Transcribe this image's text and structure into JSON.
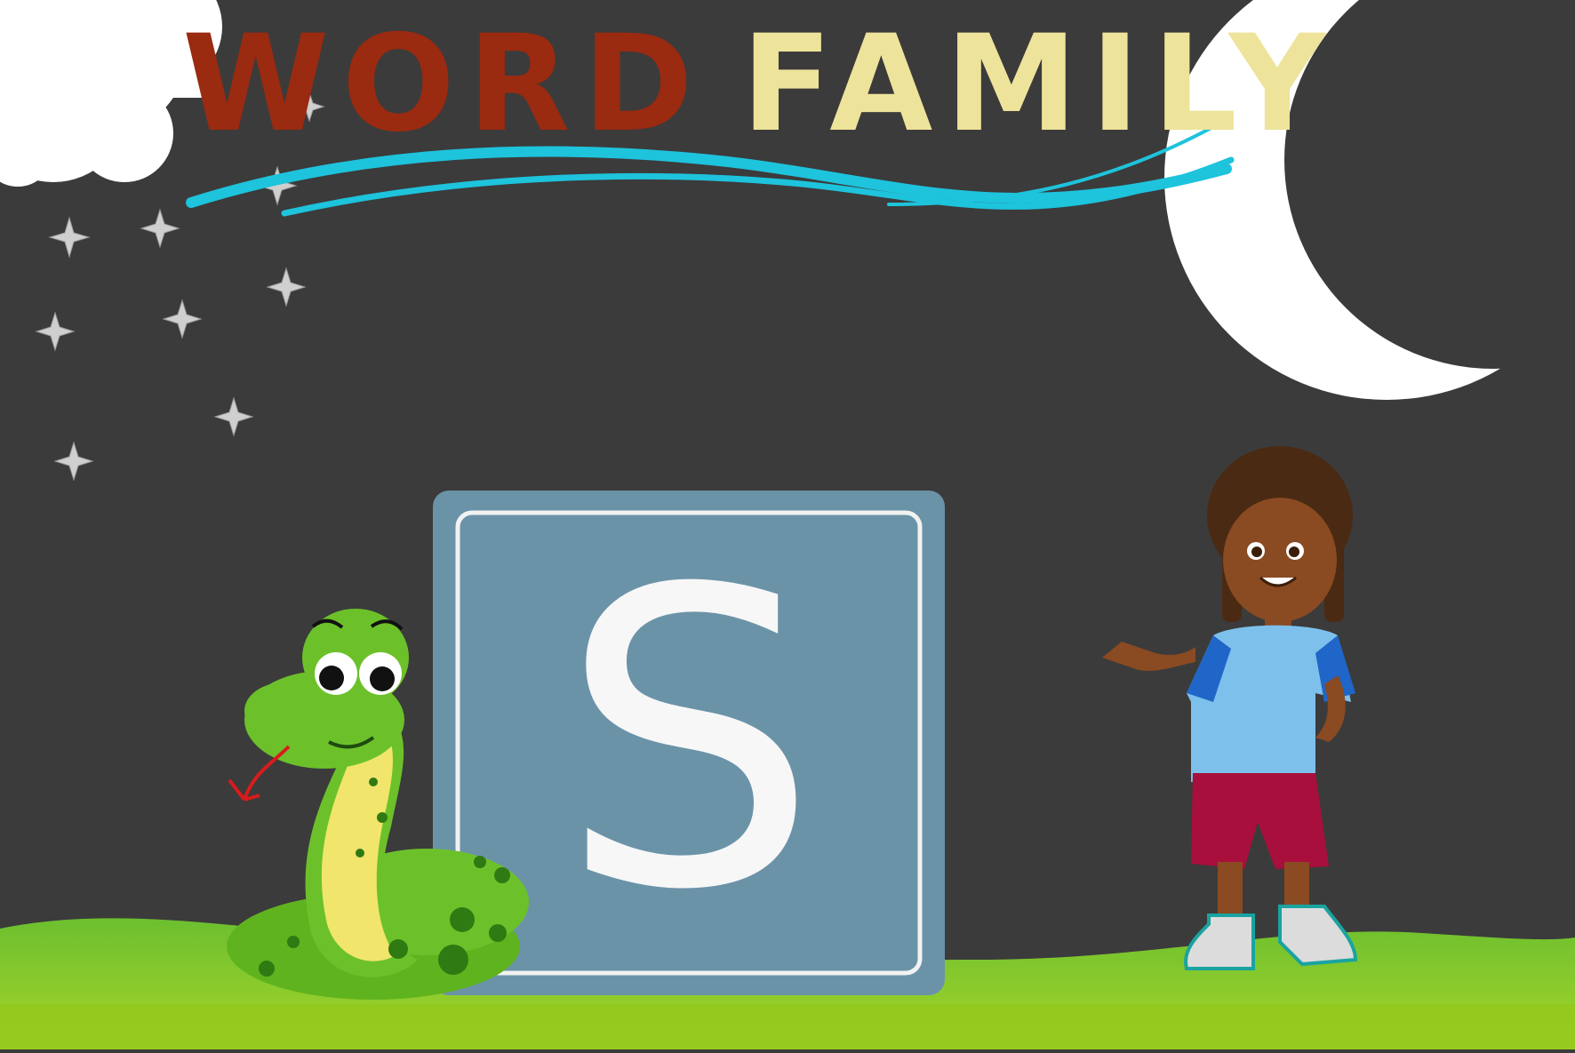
{
  "title": {
    "word1": "WORD",
    "word2": "FAMILY",
    "word1_color": "#9a2a10",
    "word2_color": "#eee39a"
  },
  "block": {
    "letter": "S",
    "color": "#6b93a8"
  },
  "icons": [
    "cloud-icon",
    "moon-icon",
    "star-icon",
    "wave-icon",
    "snake-illustration",
    "child-illustration",
    "grass-ground"
  ],
  "colors": {
    "background": "#3b3b3b",
    "grass_light": "#a7d32a",
    "grass_dark": "#6bbb2c",
    "wave": "#1ec3dc"
  }
}
